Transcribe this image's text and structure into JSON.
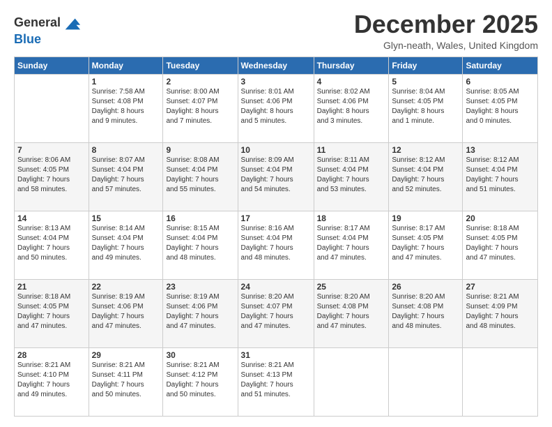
{
  "header": {
    "logo_line1": "General",
    "logo_line2": "Blue",
    "month_title": "December 2025",
    "location": "Glyn-neath, Wales, United Kingdom"
  },
  "days_of_week": [
    "Sunday",
    "Monday",
    "Tuesday",
    "Wednesday",
    "Thursday",
    "Friday",
    "Saturday"
  ],
  "weeks": [
    [
      {
        "day": "",
        "info": ""
      },
      {
        "day": "1",
        "info": "Sunrise: 7:58 AM\nSunset: 4:08 PM\nDaylight: 8 hours\nand 9 minutes."
      },
      {
        "day": "2",
        "info": "Sunrise: 8:00 AM\nSunset: 4:07 PM\nDaylight: 8 hours\nand 7 minutes."
      },
      {
        "day": "3",
        "info": "Sunrise: 8:01 AM\nSunset: 4:06 PM\nDaylight: 8 hours\nand 5 minutes."
      },
      {
        "day": "4",
        "info": "Sunrise: 8:02 AM\nSunset: 4:06 PM\nDaylight: 8 hours\nand 3 minutes."
      },
      {
        "day": "5",
        "info": "Sunrise: 8:04 AM\nSunset: 4:05 PM\nDaylight: 8 hours\nand 1 minute."
      },
      {
        "day": "6",
        "info": "Sunrise: 8:05 AM\nSunset: 4:05 PM\nDaylight: 8 hours\nand 0 minutes."
      }
    ],
    [
      {
        "day": "7",
        "info": "Sunrise: 8:06 AM\nSunset: 4:05 PM\nDaylight: 7 hours\nand 58 minutes."
      },
      {
        "day": "8",
        "info": "Sunrise: 8:07 AM\nSunset: 4:04 PM\nDaylight: 7 hours\nand 57 minutes."
      },
      {
        "day": "9",
        "info": "Sunrise: 8:08 AM\nSunset: 4:04 PM\nDaylight: 7 hours\nand 55 minutes."
      },
      {
        "day": "10",
        "info": "Sunrise: 8:09 AM\nSunset: 4:04 PM\nDaylight: 7 hours\nand 54 minutes."
      },
      {
        "day": "11",
        "info": "Sunrise: 8:11 AM\nSunset: 4:04 PM\nDaylight: 7 hours\nand 53 minutes."
      },
      {
        "day": "12",
        "info": "Sunrise: 8:12 AM\nSunset: 4:04 PM\nDaylight: 7 hours\nand 52 minutes."
      },
      {
        "day": "13",
        "info": "Sunrise: 8:12 AM\nSunset: 4:04 PM\nDaylight: 7 hours\nand 51 minutes."
      }
    ],
    [
      {
        "day": "14",
        "info": "Sunrise: 8:13 AM\nSunset: 4:04 PM\nDaylight: 7 hours\nand 50 minutes."
      },
      {
        "day": "15",
        "info": "Sunrise: 8:14 AM\nSunset: 4:04 PM\nDaylight: 7 hours\nand 49 minutes."
      },
      {
        "day": "16",
        "info": "Sunrise: 8:15 AM\nSunset: 4:04 PM\nDaylight: 7 hours\nand 48 minutes."
      },
      {
        "day": "17",
        "info": "Sunrise: 8:16 AM\nSunset: 4:04 PM\nDaylight: 7 hours\nand 48 minutes."
      },
      {
        "day": "18",
        "info": "Sunrise: 8:17 AM\nSunset: 4:04 PM\nDaylight: 7 hours\nand 47 minutes."
      },
      {
        "day": "19",
        "info": "Sunrise: 8:17 AM\nSunset: 4:05 PM\nDaylight: 7 hours\nand 47 minutes."
      },
      {
        "day": "20",
        "info": "Sunrise: 8:18 AM\nSunset: 4:05 PM\nDaylight: 7 hours\nand 47 minutes."
      }
    ],
    [
      {
        "day": "21",
        "info": "Sunrise: 8:18 AM\nSunset: 4:05 PM\nDaylight: 7 hours\nand 47 minutes."
      },
      {
        "day": "22",
        "info": "Sunrise: 8:19 AM\nSunset: 4:06 PM\nDaylight: 7 hours\nand 47 minutes."
      },
      {
        "day": "23",
        "info": "Sunrise: 8:19 AM\nSunset: 4:06 PM\nDaylight: 7 hours\nand 47 minutes."
      },
      {
        "day": "24",
        "info": "Sunrise: 8:20 AM\nSunset: 4:07 PM\nDaylight: 7 hours\nand 47 minutes."
      },
      {
        "day": "25",
        "info": "Sunrise: 8:20 AM\nSunset: 4:08 PM\nDaylight: 7 hours\nand 47 minutes."
      },
      {
        "day": "26",
        "info": "Sunrise: 8:20 AM\nSunset: 4:08 PM\nDaylight: 7 hours\nand 48 minutes."
      },
      {
        "day": "27",
        "info": "Sunrise: 8:21 AM\nSunset: 4:09 PM\nDaylight: 7 hours\nand 48 minutes."
      }
    ],
    [
      {
        "day": "28",
        "info": "Sunrise: 8:21 AM\nSunset: 4:10 PM\nDaylight: 7 hours\nand 49 minutes."
      },
      {
        "day": "29",
        "info": "Sunrise: 8:21 AM\nSunset: 4:11 PM\nDaylight: 7 hours\nand 50 minutes."
      },
      {
        "day": "30",
        "info": "Sunrise: 8:21 AM\nSunset: 4:12 PM\nDaylight: 7 hours\nand 50 minutes."
      },
      {
        "day": "31",
        "info": "Sunrise: 8:21 AM\nSunset: 4:13 PM\nDaylight: 7 hours\nand 51 minutes."
      },
      {
        "day": "",
        "info": ""
      },
      {
        "day": "",
        "info": ""
      },
      {
        "day": "",
        "info": ""
      }
    ]
  ]
}
